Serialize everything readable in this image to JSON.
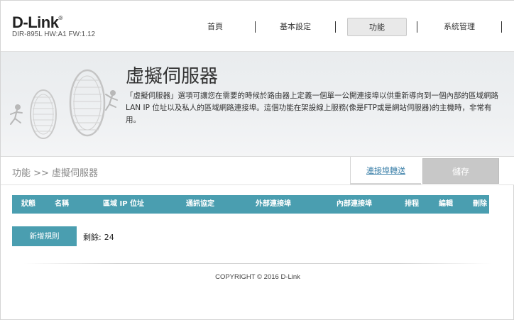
{
  "brand": {
    "logo": "D-Link",
    "model": "DIR-895L HW:A1 FW:1.12"
  },
  "nav": {
    "items": [
      {
        "label": "首頁",
        "active": false
      },
      {
        "label": "基本設定",
        "active": false
      },
      {
        "label": "功能",
        "active": true
      },
      {
        "label": "系統管理",
        "active": false
      }
    ]
  },
  "banner": {
    "title": "虛擬伺服器",
    "description": "「虛擬伺服器」選項可讓您在需要的時候於路由器上定義一個單一公開連接埠以供重新導向到一個內部的區域網路 LAN IP 位址以及私人的區域網路連接埠。這個功能在架設線上服務(像是FTP或是網站伺服器)的主機時，非常有用。"
  },
  "breadcrumb": "功能 >> 虛擬伺服器",
  "actions": {
    "port_forwarding_label": "連接埠轉送",
    "save_label": "儲存"
  },
  "table": {
    "columns": [
      "狀態",
      "名稱",
      "區域 IP 位址",
      "通訊協定",
      "外部連接埠",
      "內部連接埠",
      "排程",
      "編輯",
      "刪除"
    ]
  },
  "add_rule": {
    "button_label": "新增規則",
    "remaining_label": "剩餘:",
    "remaining_value": "24"
  },
  "footer": {
    "copyright": "COPYRIGHT © 2016 D-Link"
  },
  "colors": {
    "accent": "#4a9eb0",
    "link": "#3a7fa8",
    "save_disabled": "#c8c8c8"
  }
}
